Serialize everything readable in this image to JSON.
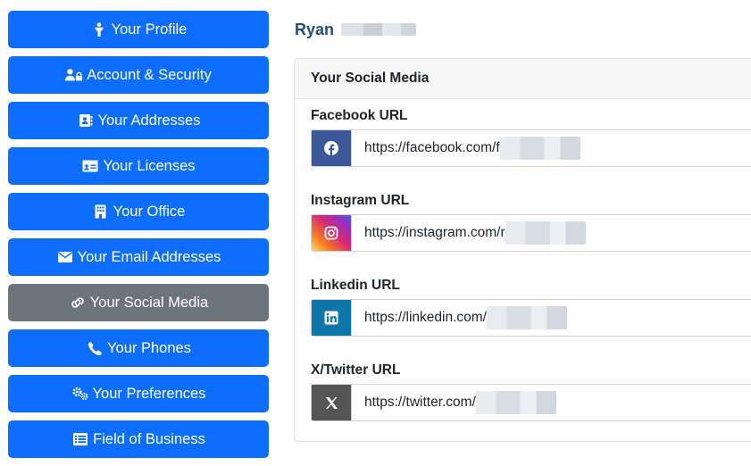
{
  "sidebar": {
    "items": [
      {
        "label": "Your Profile",
        "icon": "person-icon"
      },
      {
        "label": "Account & Security",
        "icon": "users-lock-icon"
      },
      {
        "label": "Your Addresses",
        "icon": "address-book-icon"
      },
      {
        "label": "Your Licenses",
        "icon": "id-card-icon"
      },
      {
        "label": "Your Office",
        "icon": "building-icon"
      },
      {
        "label": "Your Email Addresses",
        "icon": "envelope-icon"
      },
      {
        "label": "Your Social Media",
        "icon": "link-icon",
        "active": true
      },
      {
        "label": "Your Phones",
        "icon": "phone-icon"
      },
      {
        "label": "Your Preferences",
        "icon": "gears-icon"
      },
      {
        "label": "Field of Business",
        "icon": "list-icon"
      }
    ]
  },
  "user": {
    "first_name": "Ryan"
  },
  "card": {
    "title": "Your Social Media",
    "fields": [
      {
        "label": "Facebook URL",
        "value": "https://facebook.com/f",
        "icon": "facebook-icon",
        "color": "#3b5998"
      },
      {
        "label": "Instagram URL",
        "value": "https://instagram.com/r",
        "icon": "instagram-icon",
        "color": "#e1306c"
      },
      {
        "label": "Linkedin URL",
        "value": "https://linkedin.com/",
        "icon": "linkedin-icon",
        "color": "#0e76a8"
      },
      {
        "label": "X/Twitter URL",
        "value": "https://twitter.com/",
        "icon": "x-twitter-icon",
        "color": "#555555"
      }
    ]
  },
  "colors": {
    "primary": "#0d6efd",
    "secondary": "#6c757d",
    "name": "#1f4e79"
  }
}
